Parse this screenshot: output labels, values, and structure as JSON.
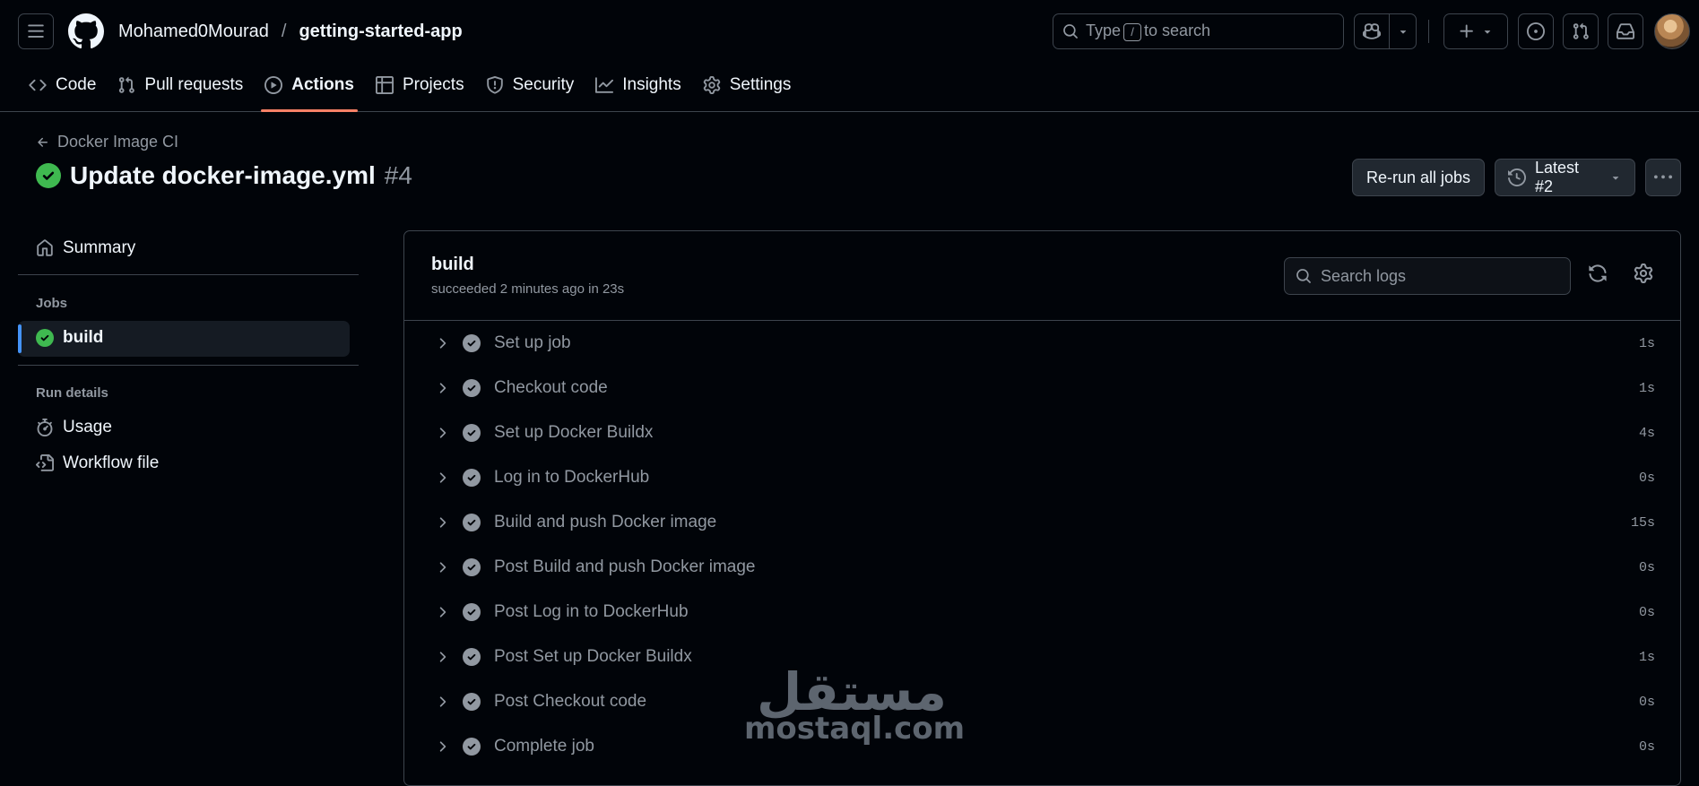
{
  "header": {
    "owner": "Mohamed0Mourad",
    "separator": "/",
    "repo": "getting-started-app",
    "search": {
      "prefix": "Type",
      "key": "/",
      "suffix": "to search"
    }
  },
  "tabs": [
    {
      "label": "Code",
      "icon": "code-icon",
      "active": false
    },
    {
      "label": "Pull requests",
      "icon": "pull-request-icon",
      "active": false
    },
    {
      "label": "Actions",
      "icon": "play-icon",
      "active": true
    },
    {
      "label": "Projects",
      "icon": "table-icon",
      "active": false
    },
    {
      "label": "Security",
      "icon": "shield-icon",
      "active": false
    },
    {
      "label": "Insights",
      "icon": "graph-icon",
      "active": false
    },
    {
      "label": "Settings",
      "icon": "gear-icon",
      "active": false
    }
  ],
  "run": {
    "workflow": "Docker Image CI",
    "title": "Update docker-image.yml",
    "number": "#4",
    "rerun_label": "Re-run all jobs",
    "attempt_label": "Latest #2"
  },
  "sidebar": {
    "summary": "Summary",
    "jobs_heading": "Jobs",
    "job": "build",
    "run_details_heading": "Run details",
    "usage": "Usage",
    "workflow_file": "Workflow file"
  },
  "job": {
    "name": "build",
    "status": "succeeded 2 minutes ago in 23s",
    "search_placeholder": "Search logs",
    "steps": [
      {
        "label": "Set up job",
        "duration": "1s"
      },
      {
        "label": "Checkout code",
        "duration": "1s"
      },
      {
        "label": "Set up Docker Buildx",
        "duration": "4s"
      },
      {
        "label": "Log in to DockerHub",
        "duration": "0s"
      },
      {
        "label": "Build and push Docker image",
        "duration": "15s"
      },
      {
        "label": "Post Build and push Docker image",
        "duration": "0s"
      },
      {
        "label": "Post Log in to DockerHub",
        "duration": "0s"
      },
      {
        "label": "Post Set up Docker Buildx",
        "duration": "1s"
      },
      {
        "label": "Post Checkout code",
        "duration": "0s"
      },
      {
        "label": "Complete job",
        "duration": "0s"
      }
    ]
  },
  "watermark": {
    "arabic": "مستقل",
    "latin": "mostaql.com"
  },
  "colors": {
    "background": "#010409",
    "border": "#3d444d",
    "muted": "#9198a1",
    "success": "#3fb950",
    "accent_underline": "#f78166",
    "active_bar": "#4493f8"
  }
}
